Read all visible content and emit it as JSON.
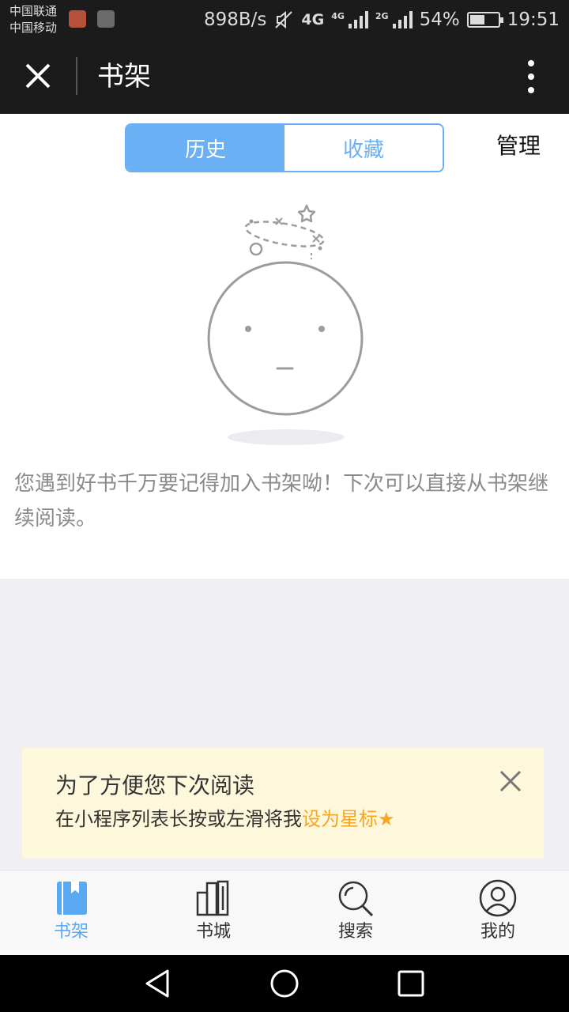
{
  "status_bar": {
    "carrier_1": "中国联通",
    "carrier_2": "中国移动",
    "net_speed": "898B/s",
    "net_4g": "4G",
    "sig1_tag": "4G",
    "sig2_tag": "2G",
    "battery": "54%",
    "battery_level": 0.54,
    "time": "19:51"
  },
  "header": {
    "title": "书架"
  },
  "segments": {
    "history": "历史",
    "favorites": "收藏",
    "active": "history"
  },
  "manage_label": "管理",
  "empty_message": "您遇到好书千万要记得加入书架呦！下次可以直接从书架继续阅读。",
  "tip": {
    "title": "为了方便您下次阅读",
    "body": "在小程序列表长按或左滑将我",
    "highlight": "设为星标★"
  },
  "tabbar": {
    "items": [
      {
        "label": "书架",
        "icon": "bookshelf-icon",
        "active": true
      },
      {
        "label": "书城",
        "icon": "bookstore-icon",
        "active": false
      },
      {
        "label": "搜索",
        "icon": "search-icon",
        "active": false
      },
      {
        "label": "我的",
        "icon": "profile-icon",
        "active": false
      }
    ]
  },
  "colors": {
    "accent": "#6ab0f4",
    "highlight": "#f5a623",
    "banner_bg": "#fdf8dc"
  }
}
